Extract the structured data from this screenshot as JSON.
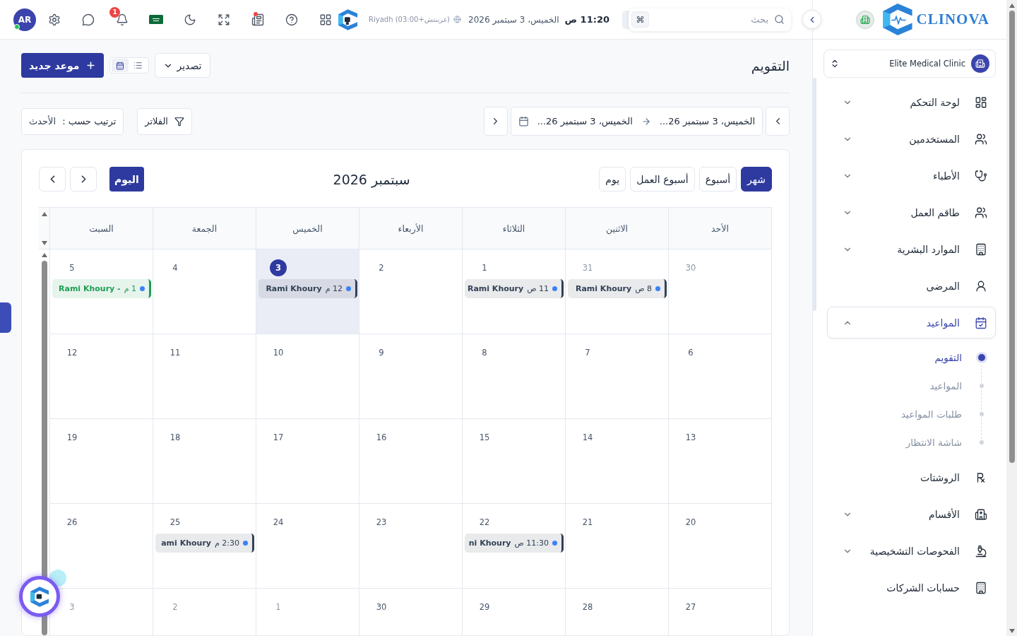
{
  "topbar": {
    "search": {
      "placeholder": "بحث",
      "shortcut": "⌘"
    },
    "time": "11:20 ص",
    "date": "الخميس، 3 سبتمبر 2026",
    "timezone": "(غرينتش+03:00) Riyadh",
    "reports": {
      "alert": true
    },
    "notifications": {
      "count": "1"
    },
    "user": {
      "initials": "AR",
      "online": true
    }
  },
  "sidebar": {
    "brand": "CLINOVA",
    "clinic": "Elite Medical Clinic",
    "items": [
      {
        "label": "لوحة التحكم",
        "kind": "group",
        "expanded": false,
        "selected": false
      },
      {
        "label": "المستخدمين",
        "kind": "group",
        "expanded": false,
        "selected": false
      },
      {
        "label": "الأطباء",
        "kind": "group",
        "expanded": false,
        "selected": false
      },
      {
        "label": "طاقم العمل",
        "kind": "group",
        "expanded": false,
        "selected": false
      },
      {
        "label": "الموارد البشرية",
        "kind": "group",
        "expanded": false,
        "selected": false
      },
      {
        "label": "المرضى",
        "kind": "link",
        "selected": false
      },
      {
        "label": "المواعيد",
        "kind": "group",
        "expanded": true,
        "selected": true,
        "children": [
          {
            "label": "التقويم",
            "selected": true
          },
          {
            "label": "المواعيد",
            "selected": false
          },
          {
            "label": "طلبات المواعيد",
            "selected": false
          },
          {
            "label": "شاشة الانتظار",
            "selected": false
          }
        ]
      },
      {
        "label": "الروشتات",
        "kind": "link",
        "selected": false
      },
      {
        "label": "الأقسام",
        "kind": "group",
        "expanded": false,
        "selected": false
      },
      {
        "label": "الفحوصات التشخيصية",
        "kind": "group",
        "expanded": false,
        "selected": false
      },
      {
        "label": "حسابات الشركات",
        "kind": "link",
        "selected": false
      }
    ]
  },
  "page": {
    "title": "التقويم",
    "export": "تصدير",
    "layout_toggle": [
      {
        "kind": "list",
        "selected": false
      },
      {
        "kind": "calendar",
        "selected": true
      }
    ],
    "new_appointment": "موعد جديد"
  },
  "filters_bar": {
    "range_start": "الخميس، 3 سبتمبر 26...",
    "range_end": "الخميس، 3 سبتمبر 26...",
    "filters": "الفلاتر",
    "sort_label": "ترتيب حسب :",
    "sort_value": "الأحدث"
  },
  "calendar": {
    "views": [
      {
        "label": "شهر",
        "selected": true
      },
      {
        "label": "أسبوع",
        "selected": false
      },
      {
        "label": "أسبوع العمل",
        "selected": false
      },
      {
        "label": "يوم",
        "selected": false
      }
    ],
    "title": "سبتمبر 2026",
    "today_button": "اليوم",
    "weekdays": [
      "الأحد",
      "الاثنين",
      "الثلاثاء",
      "الأربعاء",
      "الخميس",
      "الجمعة",
      "السبت"
    ],
    "weeks": [
      [
        {
          "day": "30",
          "outside": true,
          "today": false
        },
        {
          "day": "31",
          "outside": true,
          "today": false,
          "events": [
            {
              "time": "8 ص",
              "title": "Rami Khoury",
              "color": "#334155"
            }
          ]
        },
        {
          "day": "1",
          "outside": false,
          "today": false,
          "events": [
            {
              "time": "11 ص",
              "title": "Rami Khoury",
              "color": "#334155"
            }
          ]
        },
        {
          "day": "2",
          "outside": false,
          "today": false
        },
        {
          "day": "3",
          "outside": false,
          "today": true,
          "events": [
            {
              "time": "12 م",
              "title": "Rami Khoury",
              "color": "#334155"
            }
          ]
        },
        {
          "day": "4",
          "outside": false,
          "today": false
        },
        {
          "day": "5",
          "outside": false,
          "today": false,
          "events": [
            {
              "time": "1 م",
              "title": "Rami Khoury -",
              "color": "#1f9d55"
            }
          ]
        }
      ],
      [
        {
          "day": "6",
          "outside": false,
          "today": false
        },
        {
          "day": "7",
          "outside": false,
          "today": false
        },
        {
          "day": "8",
          "outside": false,
          "today": false
        },
        {
          "day": "9",
          "outside": false,
          "today": false
        },
        {
          "day": "10",
          "outside": false,
          "today": false
        },
        {
          "day": "11",
          "outside": false,
          "today": false
        },
        {
          "day": "12",
          "outside": false,
          "today": false
        }
      ],
      [
        {
          "day": "13",
          "outside": false,
          "today": false
        },
        {
          "day": "14",
          "outside": false,
          "today": false
        },
        {
          "day": "15",
          "outside": false,
          "today": false
        },
        {
          "day": "16",
          "outside": false,
          "today": false
        },
        {
          "day": "17",
          "outside": false,
          "today": false
        },
        {
          "day": "18",
          "outside": false,
          "today": false
        },
        {
          "day": "19",
          "outside": false,
          "today": false
        }
      ],
      [
        {
          "day": "20",
          "outside": false,
          "today": false
        },
        {
          "day": "21",
          "outside": false,
          "today": false
        },
        {
          "day": "22",
          "outside": false,
          "today": false,
          "events": [
            {
              "time": "11:30 ص",
              "title": "ni Khoury",
              "color": "#334155"
            }
          ]
        },
        {
          "day": "23",
          "outside": false,
          "today": false
        },
        {
          "day": "24",
          "outside": false,
          "today": false
        },
        {
          "day": "25",
          "outside": false,
          "today": false,
          "events": [
            {
              "time": "2:30 م",
              "title": "ami Khoury",
              "color": "#334155"
            }
          ]
        },
        {
          "day": "26",
          "outside": false,
          "today": false
        }
      ],
      [
        {
          "day": "27",
          "outside": false,
          "today": false
        },
        {
          "day": "28",
          "outside": false,
          "today": false
        },
        {
          "day": "29",
          "outside": false,
          "today": false
        },
        {
          "day": "30",
          "outside": false,
          "today": false
        },
        {
          "day": "1",
          "outside": true,
          "today": false
        },
        {
          "day": "2",
          "outside": true,
          "today": false
        },
        {
          "day": "3",
          "outside": true,
          "today": false
        }
      ]
    ]
  }
}
